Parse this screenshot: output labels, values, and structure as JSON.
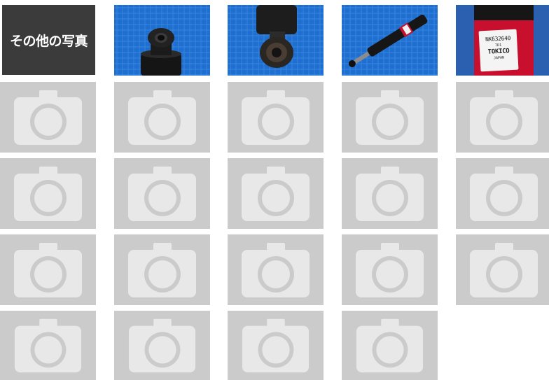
{
  "gallery": {
    "other_photos_label": "その他の写真",
    "colors": {
      "other_tile_bg": "#3b3b3b",
      "placeholder_bg": "#cbcbcb",
      "placeholder_icon": "#e8e8e8",
      "tarp_blue": "#1f6fd1",
      "shock_body": "#1a1a1a",
      "shock_red_band": "#c8102e"
    },
    "photos": [
      {
        "subject": "shock-absorber-top-bushing-closeup",
        "icon": "photo"
      },
      {
        "subject": "shock-absorber-eye-bushing-closeup",
        "icon": "photo"
      },
      {
        "subject": "shock-absorber-full-length",
        "icon": "photo"
      },
      {
        "subject": "shock-absorber-label-closeup",
        "icon": "photo",
        "label_text": {
          "part_number": "NK632640",
          "code": "TD1",
          "brand": "TOKICO",
          "origin": "JAPAN"
        }
      }
    ],
    "placeholder_icon": "camera-icon",
    "placeholder_count": 19
  }
}
